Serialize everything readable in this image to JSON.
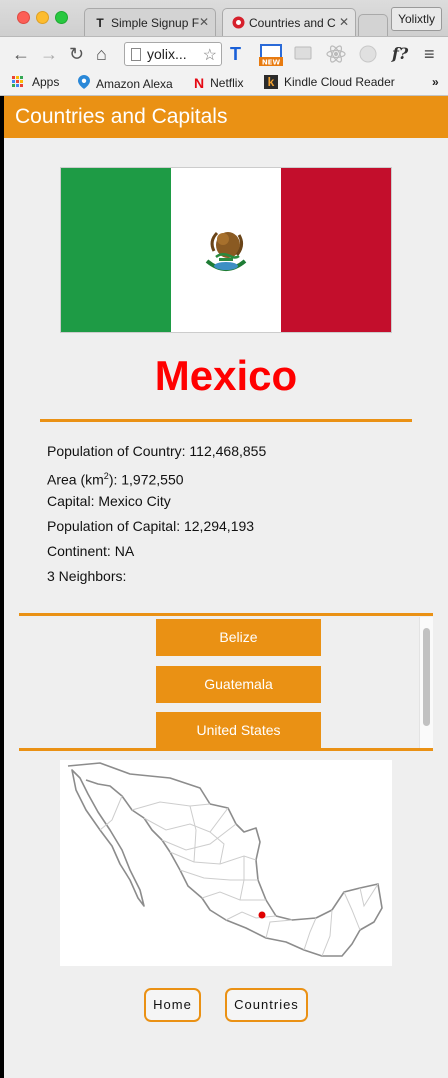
{
  "browser": {
    "tabs": [
      {
        "title": "Simple Signup F"
      },
      {
        "title": "Countries and C"
      }
    ],
    "profile_name": "Yolixtly",
    "url": "yolix...",
    "bookmarks": [
      {
        "label": "Apps"
      },
      {
        "label": "Amazon Alexa"
      },
      {
        "label": "Netflix"
      },
      {
        "label": "Kindle Cloud Reader"
      }
    ],
    "more_bookmarks": "»",
    "extension_new_badge": "NEW",
    "extension_f_label": "f?"
  },
  "app": {
    "title": "Countries and Capitals"
  },
  "country": {
    "name": "Mexico",
    "population_label": "Population of Country: 112,468,855",
    "area_prefix": "Area (km",
    "area_sup": "2",
    "area_suffix": "): 1,972,550",
    "capital_label": "Capital: Mexico City",
    "capital_population_label": "Population of Capital: 12,294,193",
    "continent_label": "Continent: NA",
    "neighbors_label": "3 Neighbors:",
    "neighbors": [
      "Belize",
      "Guatemala",
      "United States"
    ]
  },
  "nav": {
    "home": "Home",
    "countries": "Countries"
  },
  "colors": {
    "accent": "#ea9114",
    "country_name": "#ff0000",
    "flag_green": "#1e9b45",
    "flag_white": "#ffffff",
    "flag_red": "#c30e2c",
    "capital_marker": "#e00000"
  }
}
